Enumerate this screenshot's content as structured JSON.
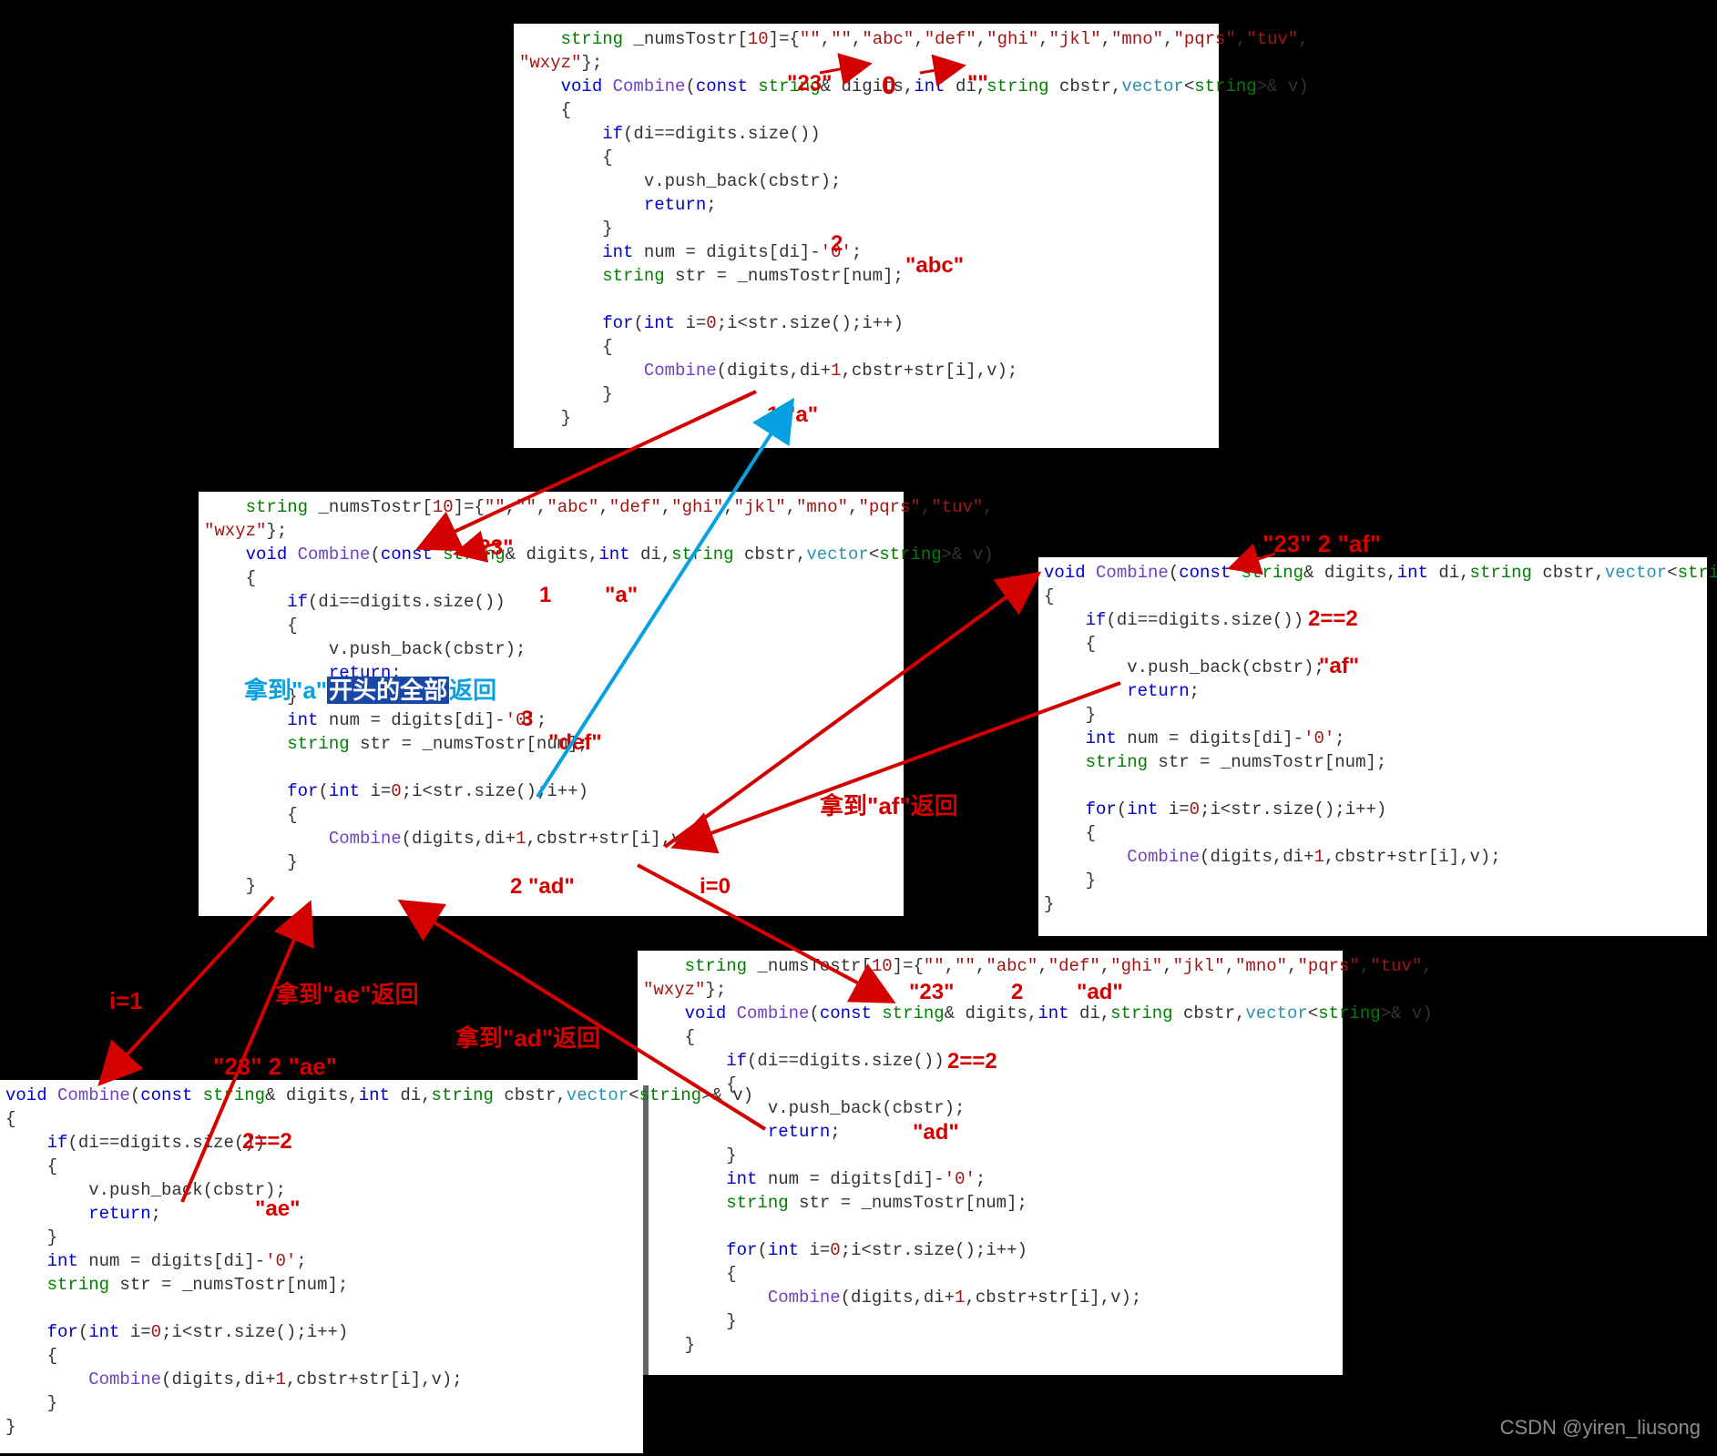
{
  "code": {
    "top": "    string _numsTostr[10]={\"\",\"\",\"abc\",\"def\",\"ghi\",\"jkl\",\"mno\",\"pqrs\",\"tuv\",\n\"wxyz\"};\n    void Combine(const string& digits,int di,string cbstr,vector<string>& v)\n    {\n        if(di==digits.size())\n        {\n            v.push_back(cbstr);\n            return;\n        }\n        int num = digits[di]-'0';\n        string str = _numsTostr[num];\n\n        for(int i=0;i<str.size();i++)\n        {\n            Combine(digits,di+1,cbstr+str[i],v);\n        }\n    }",
    "left": "    string _numsTostr[10]={\"\",\"\",\"abc\",\"def\",\"ghi\",\"jkl\",\"mno\",\"pqrs\",\"tuv\",\n\"wxyz\"};\n    void Combine(const string& digits,int di,string cbstr,vector<string>& v)\n    {\n        if(di==digits.size())\n        {\n            v.push_back(cbstr);\n            return;\n        }\n        int num = digits[di]-'0';\n        string str = _numsTostr[num];\n\n        for(int i=0;i<str.size();i++)\n        {\n            Combine(digits,di+1,cbstr+str[i],v);\n        }\n    }",
    "right": "void Combine(const string& digits,int di,string cbstr,vector<string>& v)\n{\n    if(di==digits.size())\n    {\n        v.push_back(cbstr);\n        return;\n    }\n    int num = digits[di]-'0';\n    string str = _numsTostr[num];\n\n    for(int i=0;i<str.size();i++)\n    {\n        Combine(digits,di+1,cbstr+str[i],v);\n    }\n}",
    "bottom_mid": "    string _numsTostr[10]={\"\",\"\",\"abc\",\"def\",\"ghi\",\"jkl\",\"mno\",\"pqrs\",\"tuv\",\n\"wxyz\"};\n    void Combine(const string& digits,int di,string cbstr,vector<string>& v)\n    {\n        if(di==digits.size())\n        {\n            v.push_back(cbstr);\n            return;\n        }\n        int num = digits[di]-'0';\n        string str = _numsTostr[num];\n\n        for(int i=0;i<str.size();i++)\n        {\n            Combine(digits,di+1,cbstr+str[i],v);\n        }\n    }",
    "bottom_left": "void Combine(const string& digits,int di,string cbstr,vector<string>& v)\n{\n    if(di==digits.size())\n    {\n        v.push_back(cbstr);\n        return;\n    }\n    int num = digits[di]-'0';\n    string str = _numsTostr[num];\n\n    for(int i=0;i<str.size();i++)\n    {\n        Combine(digits,di+1,cbstr+str[i],v);\n    }\n}"
  },
  "annots": {
    "top_23": "\"23\"",
    "top_0": "0",
    "top_empty": "\"\"",
    "top_2": "2",
    "top_abc": "\"abc\"",
    "top_1a": "1    \"a\"",
    "left_23": "\"23\"",
    "left_1": "1",
    "left_a": "\"a\"",
    "left_3": "3",
    "left_def": "\"def\"",
    "left_cyan_pre": "拿到\"a\"",
    "left_cyan_hl": "开头的全部",
    "left_cyan_post": "返回",
    "left_2ad": "2    \"ad\"",
    "left_i0": "i=0",
    "left_af": "拿到\"af\"返回",
    "right_header": "\"23\"       2       \"af\"",
    "right_22": "2==2",
    "right_af": "\"af\"",
    "mid_23": "\"23\"",
    "mid_2": "2",
    "mid_ad": "\"ad\"",
    "mid_22": "2==2",
    "mid_ad2": "\"ad\"",
    "bl_header": "\"23\"    2       \"ae\"",
    "bl_22": "2==2",
    "bl_ae": "\"ae\"",
    "arrow_i1": "i=1",
    "arrow_ae": "拿到\"ae\"返回",
    "arrow_ad": "拿到\"ad\"返回"
  },
  "watermark": "CSDN @yiren_liusong"
}
